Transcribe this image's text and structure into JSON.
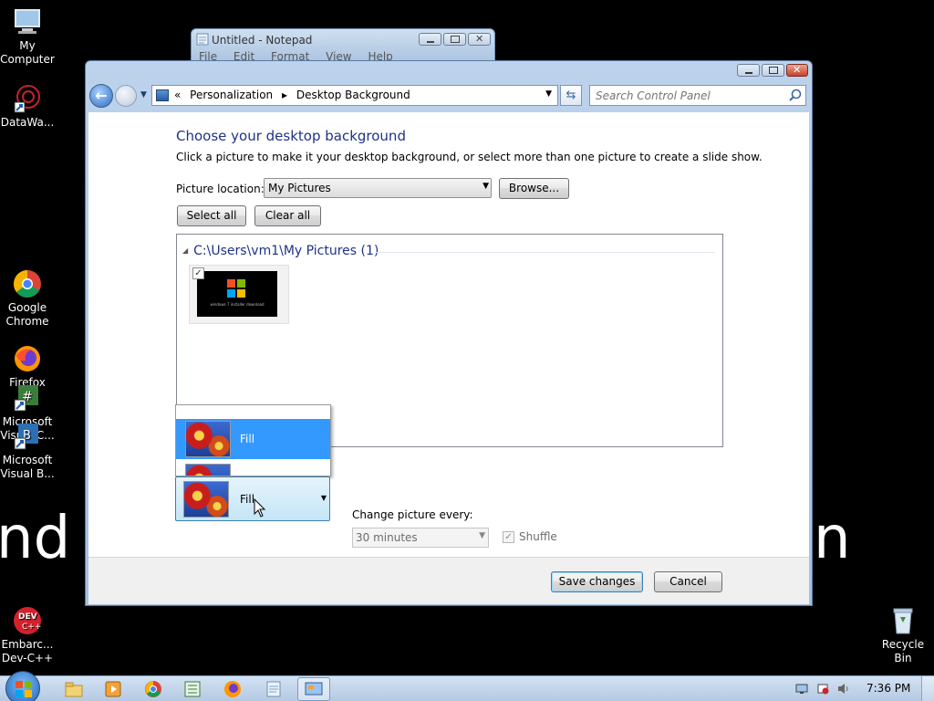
{
  "wallpaper": {
    "left_text": "nd",
    "right_text": "n",
    "bg_color": "#000000"
  },
  "desktop_icons": [
    {
      "name": "My Computer",
      "label_lines": [
        "My",
        "Computer"
      ],
      "icon": "computer-icon"
    },
    {
      "name": "DataWa...",
      "label_lines": [
        "DataWa..."
      ],
      "icon": "datawarehouse-shortcut-icon"
    },
    {
      "name": "Google Chrome",
      "label_lines": [
        "Google",
        "Chrome"
      ],
      "icon": "chrome-icon"
    },
    {
      "name": "Firefox",
      "label_lines": [
        "Firefox"
      ],
      "icon": "firefox-icon"
    },
    {
      "name": "Microsoft Visual C...",
      "label_lines": [
        "Microsoft",
        "Visual C..."
      ],
      "icon": "visual-c-shortcut-icon"
    },
    {
      "name": "Microsoft Visual B...",
      "label_lines": [
        "Microsoft",
        "Visual B..."
      ],
      "icon": "visual-b-shortcut-icon"
    },
    {
      "name": "Embarc... Dev-C++",
      "label_lines": [
        "Embarc...",
        "Dev-C++"
      ],
      "icon": "dev-cpp-icon"
    },
    {
      "name": "Recycle Bin",
      "label_lines": [
        "Recycle",
        "Bin"
      ],
      "icon": "recycle-bin-icon"
    }
  ],
  "notepad": {
    "title": "Untitled - Notepad",
    "menu": [
      "File",
      "Edit",
      "Format",
      "View",
      "Help"
    ]
  },
  "window": {
    "address": {
      "prefix": "«",
      "crumbs": [
        "Personalization",
        "Desktop Background"
      ],
      "sep": "▸"
    },
    "search_placeholder": "Search Control Panel",
    "heading": "Choose your desktop background",
    "subtext": "Click a picture to make it your desktop background, or select more than one picture to create a slide show.",
    "picture_location_label": "Picture location:",
    "picture_location_value": "My Pictures",
    "browse_label": "Browse...",
    "select_all_label": "Select all",
    "clear_all_label": "Clear all",
    "group_header": "C:\\Users\\vm1\\My Pictures (1)",
    "thumbnail": {
      "checked": true,
      "caption": "windows 7 installer download"
    },
    "position_dropdown": {
      "items": [
        {
          "label": "Fill",
          "selected": true
        },
        {
          "label": "",
          "selected": false
        }
      ],
      "current": "Fill"
    },
    "change_picture_label": "Change picture every:",
    "interval_value": "30 minutes",
    "shuffle_label": "Shuffle",
    "shuffle_checked": true,
    "save_label": "Save changes",
    "cancel_label": "Cancel"
  },
  "taskbar": {
    "pinned": [
      "explorer-icon",
      "media-player-icon",
      "chrome-icon",
      "spreadsheet-icon",
      "firefox-icon",
      "notepad-icon",
      "control-panel-icon"
    ],
    "active_index": 6,
    "clock": "7:36 PM"
  },
  "colors": {
    "accent": "#3399ff",
    "heading": "#1e3287",
    "taskbar": "#c4d6ec"
  }
}
